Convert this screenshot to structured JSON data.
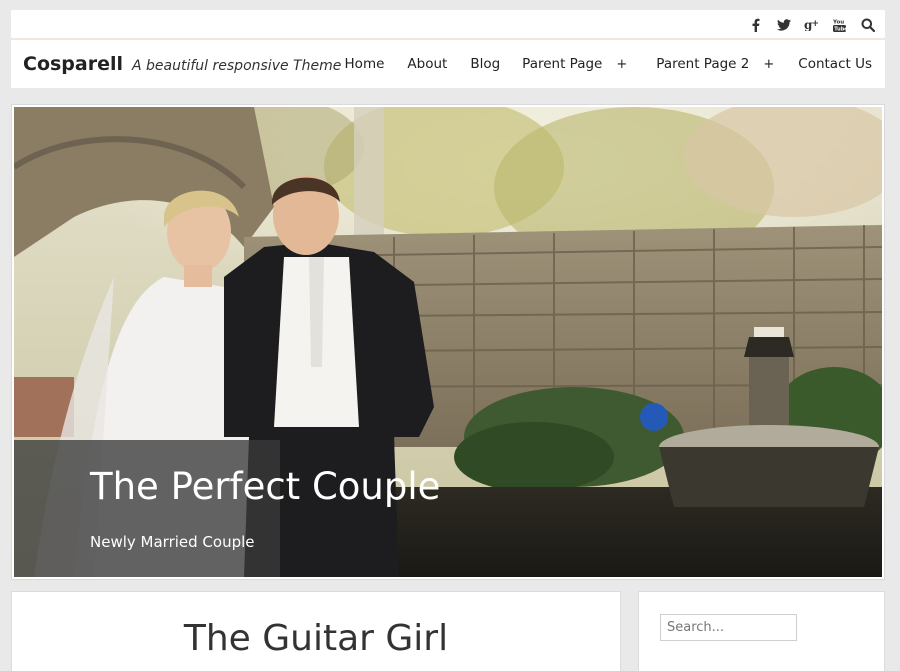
{
  "social": {
    "icons": [
      "facebook-icon",
      "twitter-icon",
      "google-plus-icon",
      "youtube-icon",
      "search-icon"
    ]
  },
  "header": {
    "site_title": "Cosparell",
    "tagline": "A beautiful responsive Theme"
  },
  "nav": {
    "items": [
      {
        "label": "Home"
      },
      {
        "label": "About"
      },
      {
        "label": "Blog"
      },
      {
        "label": "Parent Page",
        "submenu_indicator": "+"
      },
      {
        "label": "Parent Page 2",
        "submenu_indicator": "+"
      },
      {
        "label": "Contact Us"
      }
    ]
  },
  "hero": {
    "title": "The Perfect Couple",
    "subtitle": "Newly Married Couple"
  },
  "post": {
    "title": "The Guitar Girl"
  },
  "sidebar": {
    "search_placeholder": "Search..."
  }
}
